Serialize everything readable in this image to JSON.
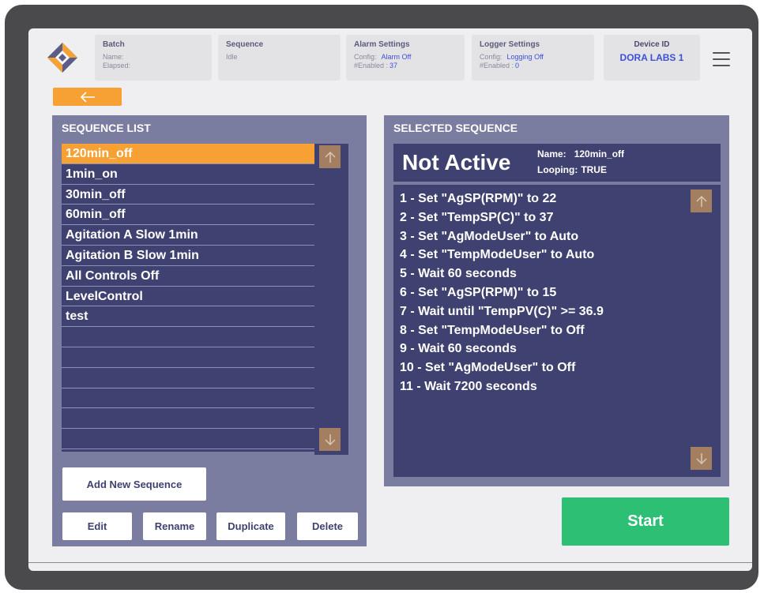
{
  "header": {
    "batch": {
      "title": "Batch",
      "name_label": "Name:",
      "elapsed_label": "Elapsed:"
    },
    "sequence": {
      "title": "Sequence",
      "status": "Idle"
    },
    "alarm": {
      "title": "Alarm Settings",
      "config_label": "Config:",
      "config_value": "Alarm Off",
      "enabled_label": "#Enabled :",
      "enabled_value": "37"
    },
    "logger": {
      "title": "Logger Settings",
      "config_label": "Config:",
      "config_value": "Logging Off",
      "enabled_label": "#Enabled :",
      "enabled_value": "0"
    },
    "device": {
      "title": "Device ID",
      "name": "DORA LABS 1"
    }
  },
  "icons": {
    "logo": "dora-logo",
    "menu": "hamburger-menu-icon",
    "back": "arrow-left-icon",
    "scroll_up": "arrow-up-icon",
    "scroll_down": "arrow-down-icon"
  },
  "sequence_list": {
    "title": "SEQUENCE LIST",
    "items": [
      "120min_off",
      "1min_on",
      "30min_off",
      "60min_off",
      "Agitation A Slow 1min",
      "Agitation B Slow 1min",
      "All Controls Off",
      "LevelControl",
      "test",
      "",
      "",
      "",
      "",
      "",
      ""
    ],
    "selected_index": 0,
    "add_button": "Add New Sequence",
    "edit_button": "Edit",
    "rename_button": "Rename",
    "duplicate_button": "Duplicate",
    "delete_button": "Delete"
  },
  "selected_sequence": {
    "title": "SELECTED SEQUENCE",
    "status": "Not Active",
    "name_label": "Name:",
    "name_value": "120min_off",
    "looping_label": "Looping:",
    "looping_value": "TRUE",
    "steps": [
      "1 - Set \"AgSP(RPM)\" to 22",
      "2 - Set \"TempSP(C)\" to 37",
      "3 - Set \"AgModeUser\" to Auto",
      "4 - Set \"TempModeUser\" to Auto",
      "5 - Wait 60 seconds",
      "6 - Set \"AgSP(RPM)\" to 15",
      "7 - Wait until \"TempPV(C)\" >= 36.9",
      "8 - Set \"TempModeUser\" to Off",
      "9 - Wait 60 seconds",
      "10 - Set \"AgModeUser\" to Off",
      "11 - Wait 7200 seconds"
    ]
  },
  "start_button": "Start",
  "colors": {
    "accent": "#f7a134",
    "panel": "#7a7ca0",
    "list_bg": "#3f4270",
    "start": "#2dbf73",
    "link": "#3d4fd8"
  }
}
